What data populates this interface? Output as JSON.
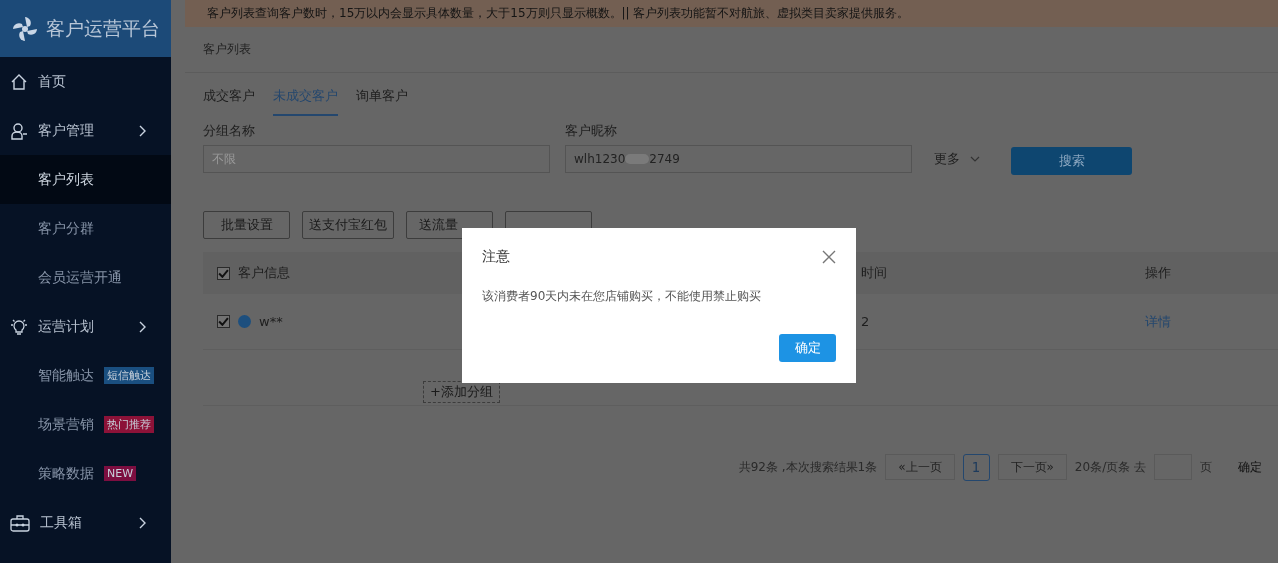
{
  "app_title": "客户运营平台",
  "sidebar": {
    "items": [
      {
        "label": "首页"
      },
      {
        "label": "客户管理",
        "children": [
          {
            "label": "客户列表",
            "selected": true
          },
          {
            "label": "客户分群",
            "selected": false
          },
          {
            "label": "会员运营开通",
            "selected": false
          }
        ]
      },
      {
        "label": "运营计划",
        "children": [
          {
            "label": "智能触达",
            "selected": false,
            "badge": {
              "text": "短信触达",
              "color": "#1a4f80"
            }
          },
          {
            "label": "场景营销",
            "selected": false,
            "badge": {
              "text": "热门推荐",
              "color": "#8c1238"
            }
          },
          {
            "label": "策略数据",
            "selected": false,
            "badge": {
              "text": "NEW",
              "color": "#7c0e40"
            }
          }
        ]
      },
      {
        "label": "工具箱",
        "expandable": true
      }
    ]
  },
  "notice": "客户列表查询客户数时，15万以内会显示具体数量，大于15万则只显示概数。|| 客户列表功能暂不对航旅、虚拟类目卖家提供服务。",
  "breadcrumb": "客户列表",
  "tabs": [
    {
      "label": "成交客户",
      "selected": false
    },
    {
      "label": "未成交客户",
      "selected": true
    },
    {
      "label": "询单客户",
      "selected": false
    }
  ],
  "filters": [
    {
      "label": "分组名称",
      "placeholder": "不限"
    },
    {
      "label": "客户昵称",
      "value_start": "wlh1230",
      "value_end": "2749"
    }
  ],
  "more": "更多",
  "search_button": "搜索",
  "actions": [
    "批量设置",
    "送支付宝红包",
    "送流量"
  ],
  "table": {
    "select_all_checked": true,
    "columns": [
      "客户信息",
      "时间",
      "操作"
    ],
    "rows": [
      {
        "checked": true,
        "name": "w**",
        "time": "2",
        "action": "详情"
      }
    ]
  },
  "add_group": "+添加分组",
  "pagination": {
    "summary": "共92条 ,本次搜索结果1条",
    "prev": "«上一页",
    "pages": [
      {
        "label": "1",
        "selected": true
      }
    ],
    "next": "下一页»",
    "per_page": "20条/页条 去",
    "page_unit": "页",
    "confirm": "确定"
  },
  "dialog": {
    "title": "注意",
    "message": "该消费者90天内未在您店铺购买，不能使用禁止购买",
    "confirm": "确定"
  }
}
